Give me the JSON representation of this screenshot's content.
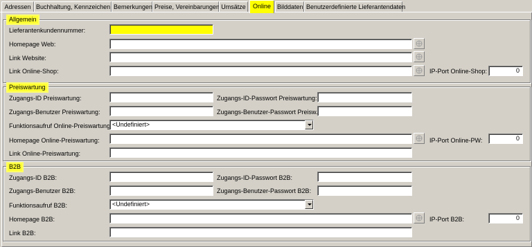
{
  "tabs": [
    {
      "label": "Adressen"
    },
    {
      "label": "Buchhaltung, Kennzeichen"
    },
    {
      "label": "Bemerkungen"
    },
    {
      "label": "Preise, Vereinbarungen"
    },
    {
      "label": "Umsätze"
    },
    {
      "label": "Online"
    },
    {
      "label": "Bilddaten"
    },
    {
      "label": "Benutzerdefinierte Lieferantendaten"
    }
  ],
  "active_tab": "Online",
  "allgemein": {
    "title": "Allgemein",
    "lieferantenkundennummer_label": "Lieferantenkundennummer:",
    "lieferantenkundennummer_value": "",
    "homepage_web_label": "Homepage Web:",
    "homepage_web_value": "",
    "link_website_label": "Link Website:",
    "link_website_value": "",
    "link_online_shop_label": "Link Online-Shop:",
    "link_online_shop_value": "",
    "ip_port_label": "IP-Port Online-Shop:",
    "ip_port_value": "0"
  },
  "preiswartung": {
    "title": "Preiswartung",
    "zugangs_id_label": "Zugangs-ID Preiswartung:",
    "zugangs_id_value": "",
    "zugangs_id_passwort_label": "Zugangs-ID-Passwort Preiswartung:",
    "zugangs_id_passwort_value": "",
    "zugangs_benutzer_label": "Zugangs-Benutzer Preiswartung:",
    "zugangs_benutzer_value": "",
    "zugangs_benutzer_passwort_label": "Zugangs-Benutzer-Passwort Preisw.:",
    "zugangs_benutzer_passwort_value": "",
    "funktionsaufruf_label": "Funktionsaufruf Online-Preiswartung:",
    "funktionsaufruf_value": "<Undefiniert>",
    "homepage_label": "Homepage Online-Preiswartung:",
    "homepage_value": "",
    "ip_port_label": "IP-Port Online-PW:",
    "ip_port_value": "0",
    "link_label": "Link Online-Preiswartung:",
    "link_value": ""
  },
  "b2b": {
    "title": "B2B",
    "zugangs_id_label": "Zugangs-ID B2B:",
    "zugangs_id_value": "",
    "zugangs_id_passwort_label": "Zugangs-ID-Passwort B2B:",
    "zugangs_id_passwort_value": "",
    "zugangs_benutzer_label": "Zugangs-Benutzer B2B:",
    "zugangs_benutzer_value": "",
    "zugangs_benutzer_passwort_label": "Zugangs-Benutzer-Passwort B2B:",
    "zugangs_benutzer_passwort_value": "",
    "funktionsaufruf_label": "Funktionsaufruf B2B:",
    "funktionsaufruf_value": "<Undefiniert>",
    "homepage_label": "Homepage B2B:",
    "homepage_value": "",
    "ip_port_label": "IP-Port B2B:",
    "ip_port_value": "0",
    "link_label": "Link B2B:",
    "link_value": ""
  },
  "icons": {
    "link_button": "globe-link-icon",
    "dropdown": "chevron-down-icon"
  },
  "colors": {
    "background": "#d4d0c8",
    "highlight": "#ffff00",
    "field": "#ffffff"
  }
}
